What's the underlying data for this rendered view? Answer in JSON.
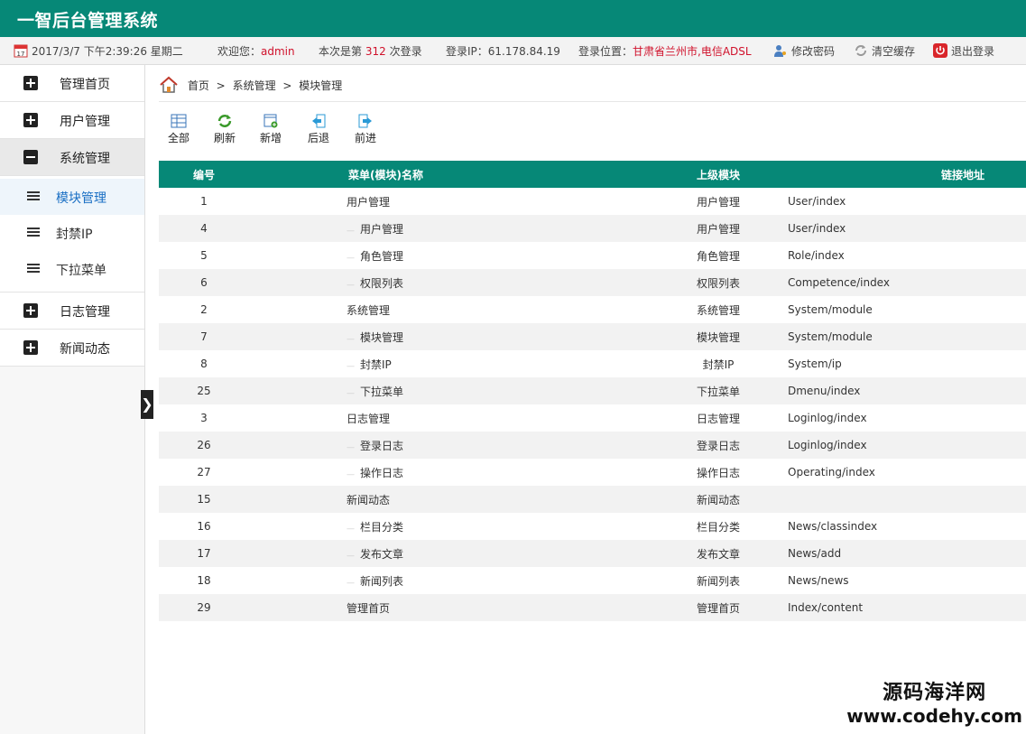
{
  "app": {
    "title": "一智后台管理系统"
  },
  "info": {
    "datetime": "2017/3/7 下午2:39:26 星期二",
    "welcome_prefix": "欢迎您：",
    "username": "admin",
    "login_prefix": "本次是第",
    "login_count": "312",
    "login_suffix": "次登录",
    "ip_label": "登录IP：61.178.84.19",
    "location_label": "登录位置：",
    "location_value": "甘肃省兰州市,电信ADSL",
    "change_pwd": "修改密码",
    "clear_cache": "清空缓存",
    "logout": "退出登录"
  },
  "sidebar": {
    "groups": [
      {
        "label": "管理首页"
      },
      {
        "label": "用户管理"
      },
      {
        "label": "系统管理"
      },
      {
        "label": "日志管理"
      },
      {
        "label": "新闻动态"
      }
    ],
    "sub": [
      {
        "label": "模块管理"
      },
      {
        "label": "封禁IP"
      },
      {
        "label": "下拉菜单"
      }
    ],
    "toggle": "❯"
  },
  "breadcrumb": {
    "home": "首页",
    "sep": ">",
    "level1": "系统管理",
    "level2": "模块管理"
  },
  "toolbar": {
    "all": "全部",
    "refresh": "刷新",
    "add": "新增",
    "back": "后退",
    "forward": "前进"
  },
  "table": {
    "headers": [
      "编号",
      "菜单(模块)名称",
      "上级模块",
      "链接地址"
    ],
    "rows": [
      {
        "id": "1",
        "name": "用户管理",
        "child": false,
        "parent": "用户管理",
        "link": "User/index"
      },
      {
        "id": "4",
        "name": "用户管理",
        "child": true,
        "parent": "用户管理",
        "link": "User/index"
      },
      {
        "id": "5",
        "name": "角色管理",
        "child": true,
        "parent": "角色管理",
        "link": "Role/index"
      },
      {
        "id": "6",
        "name": "权限列表",
        "child": true,
        "parent": "权限列表",
        "link": "Competence/index"
      },
      {
        "id": "2",
        "name": "系统管理",
        "child": false,
        "parent": "系统管理",
        "link": "System/module"
      },
      {
        "id": "7",
        "name": "模块管理",
        "child": true,
        "parent": "模块管理",
        "link": "System/module"
      },
      {
        "id": "8",
        "name": "封禁IP",
        "child": true,
        "parent": "封禁IP",
        "link": "System/ip"
      },
      {
        "id": "25",
        "name": "下拉菜单",
        "child": true,
        "parent": "下拉菜单",
        "link": "Dmenu/index"
      },
      {
        "id": "3",
        "name": "日志管理",
        "child": false,
        "parent": "日志管理",
        "link": "Loginlog/index"
      },
      {
        "id": "26",
        "name": "登录日志",
        "child": true,
        "parent": "登录日志",
        "link": "Loginlog/index"
      },
      {
        "id": "27",
        "name": "操作日志",
        "child": true,
        "parent": "操作日志",
        "link": "Operating/index"
      },
      {
        "id": "15",
        "name": "新闻动态",
        "child": false,
        "parent": "新闻动态",
        "link": ""
      },
      {
        "id": "16",
        "name": "栏目分类",
        "child": true,
        "parent": "栏目分类",
        "link": "News/classindex"
      },
      {
        "id": "17",
        "name": "发布文章",
        "child": true,
        "parent": "发布文章",
        "link": "News/add"
      },
      {
        "id": "18",
        "name": "新闻列表",
        "child": true,
        "parent": "新闻列表",
        "link": "News/news"
      },
      {
        "id": "29",
        "name": "管理首页",
        "child": false,
        "parent": "管理首页",
        "link": "Index/content"
      }
    ]
  },
  "watermark": {
    "line1": "源码海洋网",
    "line2": "www.codehy.com"
  },
  "colors": {
    "brand": "#068877",
    "highlight": "#d0112b",
    "active_link": "#1a6fc4"
  }
}
